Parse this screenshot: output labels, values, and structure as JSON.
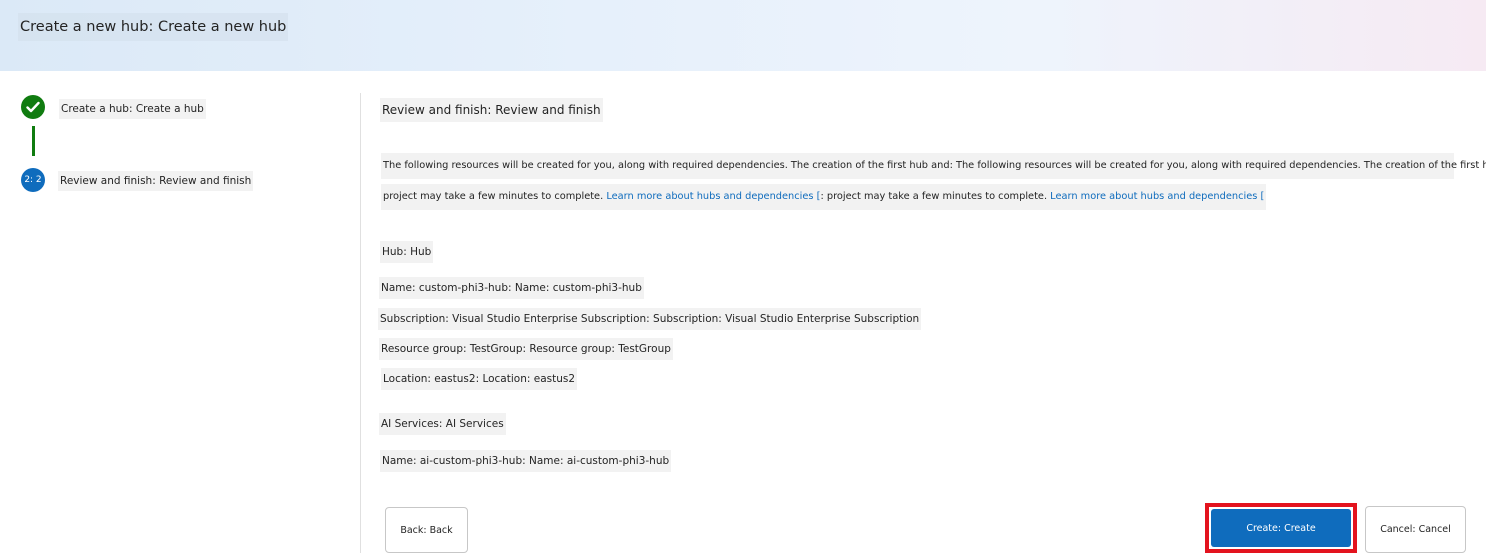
{
  "header": {
    "title": "Create a new hub: Create a new hub"
  },
  "steps": [
    {
      "label": "Create a hub: Create a hub",
      "status": "done"
    },
    {
      "label": "Review and finish: Review and finish",
      "status": "current",
      "badge": "2: 2"
    }
  ],
  "review": {
    "title": "Review and finish: Review and finish",
    "description_line1": "The following resources will be created for you, along with required dependencies. The creation of the first hub and: The following resources will be created for you, along with required dependencies. The creation of the first hub and",
    "description_line2_a": "project may take a few minutes to complete. ",
    "description_line2_link_a": "Learn more about hubs and dependencies [",
    "description_line2_b": ": project may take a few minutes to complete. ",
    "description_line2_link_b": "Learn more about hubs and dependencies [",
    "hub": {
      "title": "Hub: Hub",
      "name": "Name: custom-phi3-hub: Name: custom-phi3-hub",
      "subscription": "Subscription: Visual Studio Enterprise Subscription: Subscription: Visual Studio Enterprise Subscription",
      "resource_group": "Resource group: TestGroup: Resource group: TestGroup",
      "location": "Location: eastus2: Location: eastus2"
    },
    "ai_services": {
      "title": "AI Services: AI Services",
      "name": "Name: ai-custom-phi3-hub: Name: ai-custom-phi3-hub"
    }
  },
  "buttons": {
    "back": "Back: Back",
    "create": "Create: Create",
    "cancel": "Cancel: Cancel"
  },
  "colors": {
    "primary": "#0f6cbd",
    "success": "#107c10",
    "highlight_border": "#e3131e"
  }
}
